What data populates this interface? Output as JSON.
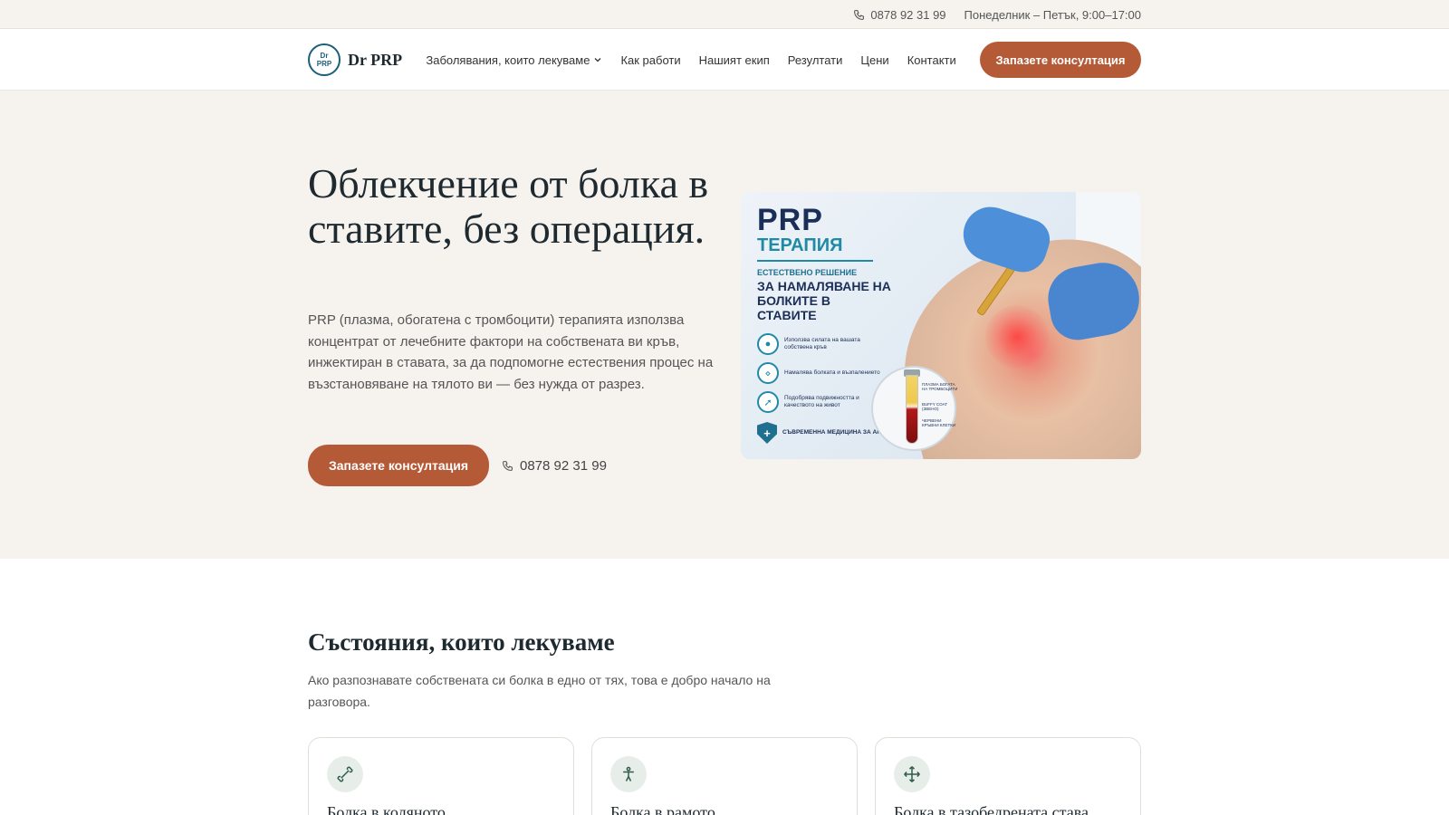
{
  "topbar": {
    "phone_icon": "phone-icon",
    "phone": "0878 92 31 99",
    "hours": "Понеделник – Петък, 9:00–17:00"
  },
  "nav": {
    "logo_text": "Dr PRP",
    "brand_name": "Dr PRP",
    "menu": [
      {
        "label": "Заболявания, които лекуваме",
        "has_dropdown": true
      },
      {
        "label": "Как работи"
      },
      {
        "label": "Нашият екип"
      },
      {
        "label": "Резултати"
      },
      {
        "label": "Цени"
      },
      {
        "label": "Контакти"
      }
    ],
    "cta_label": "Запазете консултация"
  },
  "hero": {
    "title": "Облекчение от болка в ставите, без операция.",
    "text": "PRP (плазма, обогатена с тромбоцити) терапията използва концентрат от лечебните фактори на собствената ви кръв, инжектиран в ставата, за да подпомогне естествения процес на възстановяване на тялото ви — без нужда от разрез.",
    "cta_label": "Запазете консултация",
    "phone": "0878 92 31 99",
    "image": {
      "title_line1": "PRP",
      "title_line2": "ТЕРАПИЯ",
      "subtitle": "ЕСТЕСТВЕНО РЕШЕНИЕ",
      "headline": "ЗА НАМАЛЯВАНЕ НА БОЛКИТЕ В СТАВИТЕ",
      "features": [
        {
          "icon": "drop-icon",
          "text": "Използва силата на вашата собствена кръв"
        },
        {
          "icon": "joint-icon",
          "text": "Намалява болката и възпалението"
        },
        {
          "icon": "running-icon",
          "text": "Подобрява подвижността и качеството на живот"
        }
      ],
      "badge_text": "СЪВРЕМЕННА МЕДИЦИНА ЗА АКТИВЕН ЖИВОТ",
      "tube_labels": [
        "ПЛАЗМА БОГАТА НА ТРОМБОЦИТИ",
        "BUFFY COAT (ЗВЕНО)",
        "ЧЕРВЕНИ КРЪВНИ КЛЕТКИ"
      ]
    }
  },
  "conditions": {
    "title": "Състояния, които лекуваме",
    "subtitle": "Ако разпознавате собствената си болка в едно от тях, това е добро начало на разговора.",
    "cards": [
      {
        "icon": "bone-icon",
        "title": "Болка в коляното"
      },
      {
        "icon": "person-icon",
        "title": "Болка в рамото"
      },
      {
        "icon": "move-arrows-icon",
        "title": "Болка в тазобедрената става"
      }
    ]
  },
  "colors": {
    "accent": "#b55a36",
    "hero_bg": "#f6f3ef",
    "icon_bg": "#e7eeea",
    "dark_text": "#1e2a30"
  }
}
